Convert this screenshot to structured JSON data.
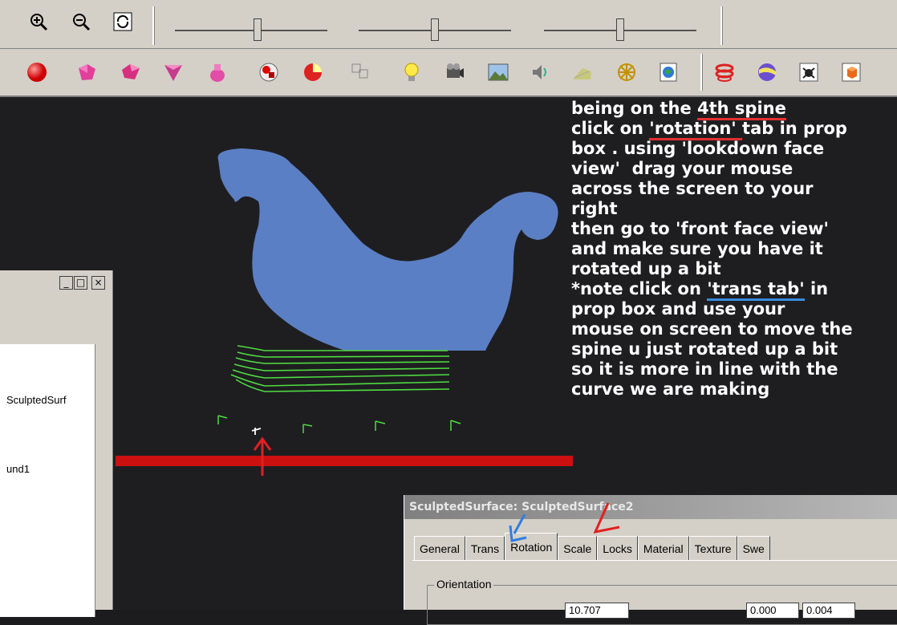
{
  "instructions": {
    "l1a": "being on the ",
    "l1u": "4th spine",
    "l2a": "click on ",
    "l2u": "'rotation' ",
    "l2b": "tab in prop",
    "l3": "box . using 'lookdown face",
    "l4": "view'  drag your mouse",
    "l5": "across the screen to your",
    "l6": "right",
    "l7": "then go to 'front face view'",
    "l8": "and make sure you have it",
    "l9": "rotated up a bit",
    "l10a": "*note click on ",
    "l10u": "'trans tab'",
    "l10b": " in",
    "l11": "prop box and use your",
    "l12": "mouse on screen to move the",
    "l13": "spine u just rotated up a bit",
    "l14": "so it is more in line with the",
    "l15": "curve we are making"
  },
  "left_panel": {
    "item1": "SculptedSurf",
    "item2": "und1",
    "minimize": "_",
    "maximize": "□",
    "close": "×"
  },
  "prop_box": {
    "title": "SculptedSurface:  SculptedSurface2",
    "tabs": [
      "General",
      "Trans",
      "Rotation",
      "Scale",
      "Locks",
      "Material",
      "Texture",
      "Swe"
    ],
    "group_label": "Orientation",
    "field1": "10.707",
    "field2": "0.000",
    "field3": "0.004"
  },
  "colors": {
    "shape_blue": "#5b7fc4",
    "rail_red": "#cc1010",
    "spine_green": "#4fdc40"
  }
}
